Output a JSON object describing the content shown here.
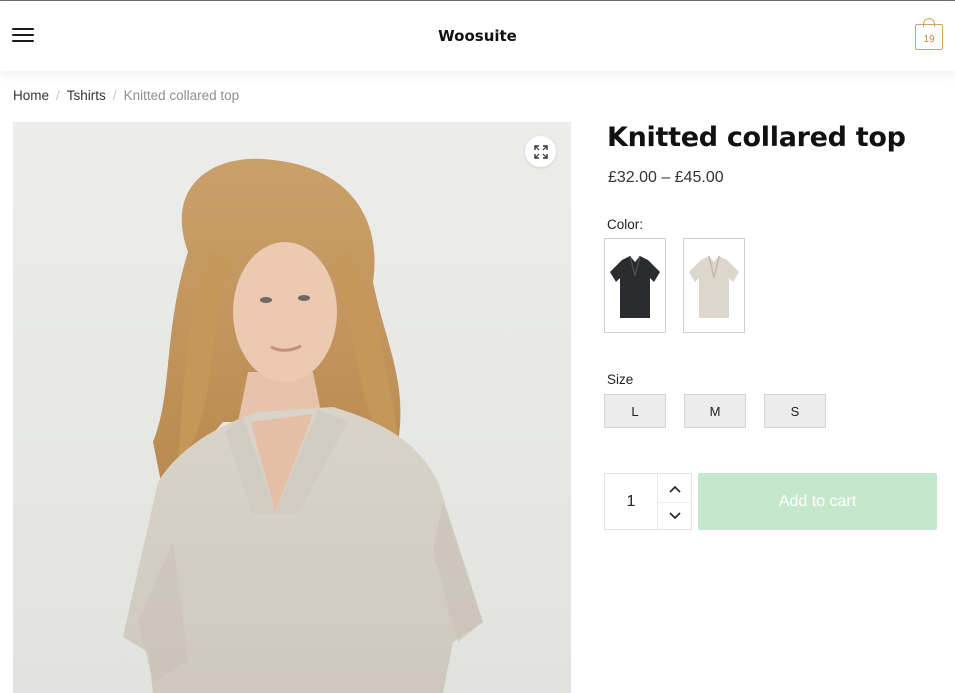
{
  "header": {
    "site_title": "Woosuite",
    "menu_icon": "hamburger-menu-icon",
    "cart_icon": "shopping-bag-icon",
    "cart_count": "19",
    "accent_color": "#d4a25a"
  },
  "breadcrumb": {
    "items": [
      "Home",
      "Tshirts"
    ],
    "current": "Knitted collared top"
  },
  "gallery": {
    "image": "woman-wearing-beige-knitted-collared-top",
    "zoom_icon": "expand-icon"
  },
  "product": {
    "title": "Knitted collared top",
    "price": "£32.00 – £45.00",
    "color_label": "Color:",
    "colors": [
      "black",
      "beige"
    ],
    "size_label": "Size",
    "sizes": [
      "L",
      "M",
      "S"
    ],
    "quantity": "1",
    "add_to_cart_label": "Add to cart",
    "add_to_cart_color": "#c5e8cd"
  }
}
